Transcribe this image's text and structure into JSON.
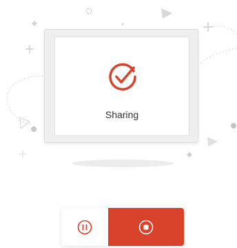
{
  "status": {
    "label": "Sharing",
    "icon": "check-circle-icon"
  },
  "controls": {
    "pause_icon": "pause-icon",
    "stop_icon": "stop-icon"
  },
  "colors": {
    "accent": "#d8412a",
    "decor": "#cfcfcf",
    "text": "#333333"
  }
}
